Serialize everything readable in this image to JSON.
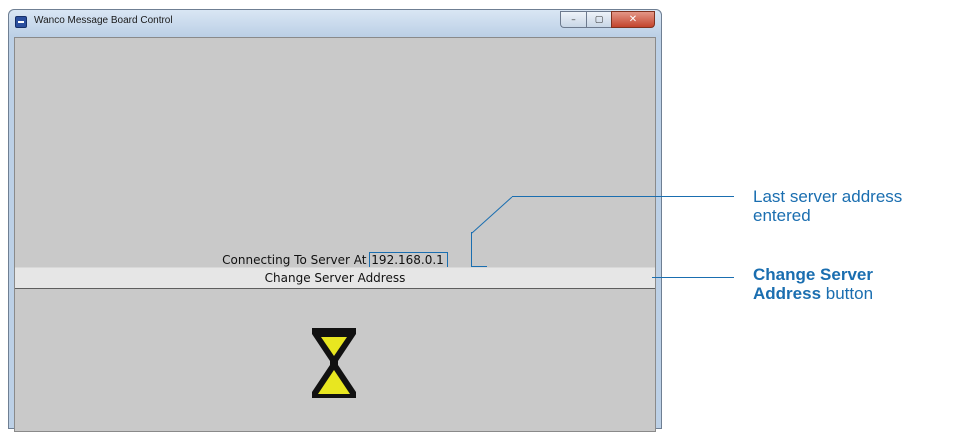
{
  "window": {
    "title": "Wanco Message Board Control",
    "minimize_glyph": "–",
    "maximize_glyph": "▢",
    "close_glyph": "✕"
  },
  "status": {
    "connecting_prefix": "Connecting To Server At ",
    "server_ip": "192.168.0.1"
  },
  "button": {
    "change_server_label": "Change Server Address"
  },
  "annotations": {
    "last_server_line1": "Last server address",
    "last_server_line2": "entered",
    "change_btn_bold1": "Change Server",
    "change_btn_bold2": "Address",
    "change_btn_rest": " button"
  },
  "colors": {
    "callout_blue": "#1a6eb0",
    "hourglass_yellow": "#e8e620",
    "hourglass_black": "#111111"
  },
  "icons": {
    "app": "app-icon",
    "busy": "hourglass-icon"
  }
}
